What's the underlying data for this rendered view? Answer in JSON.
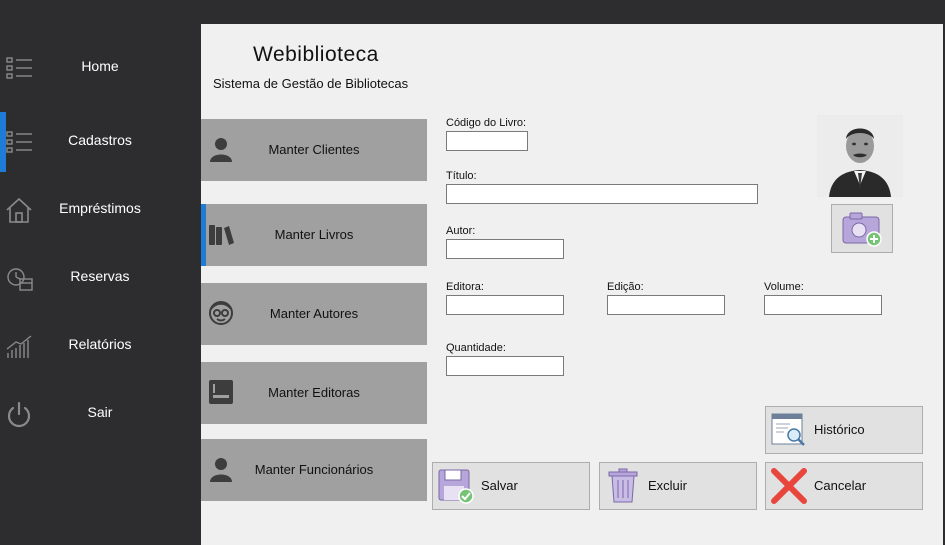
{
  "sidebar": {
    "items": [
      {
        "label": "Home",
        "icon": "home-list-icon",
        "active": false
      },
      {
        "label": "Cadastros",
        "icon": "cadastros-list-icon",
        "active": true
      },
      {
        "label": "Empréstimos",
        "icon": "house-icon",
        "active": false
      },
      {
        "label": "Reservas",
        "icon": "alarm-calendar-icon",
        "active": false
      },
      {
        "label": "Relatórios",
        "icon": "bar-chart-icon",
        "active": false
      },
      {
        "label": "Sair",
        "icon": "power-icon",
        "active": false
      }
    ]
  },
  "header": {
    "title": "Webiblioteca",
    "subtitle": "Sistema de Gestão de Bibliotecas"
  },
  "submenu": {
    "items": [
      {
        "label": "Manter Clientes",
        "icon": "person-icon"
      },
      {
        "label": "Manter Livros",
        "icon": "books-icon",
        "active": true
      },
      {
        "label": "Manter Autores",
        "icon": "author-face-icon"
      },
      {
        "label": "Manter Editoras",
        "icon": "book-icon"
      },
      {
        "label": "Manter Funcionários",
        "icon": "person-icon"
      }
    ]
  },
  "form": {
    "codigo": {
      "label": "Código do Livro:",
      "value": ""
    },
    "titulo": {
      "label": "Título:",
      "value": ""
    },
    "autor": {
      "label": "Autor:",
      "value": ""
    },
    "editora": {
      "label": "Editora:",
      "value": ""
    },
    "edicao": {
      "label": "Edição:",
      "value": ""
    },
    "volume": {
      "label": "Volume:",
      "value": ""
    },
    "quantidade": {
      "label": "Quantidade:",
      "value": ""
    }
  },
  "actions": {
    "historico": "Histórico",
    "salvar": "Salvar",
    "excluir": "Excluir",
    "cancelar": "Cancelar"
  },
  "colors": {
    "sidebar_bg": "#2d2d30",
    "accent": "#1e7bd6",
    "submenu_bg": "#a0a0a0",
    "content_bg": "#f0f0f0"
  }
}
